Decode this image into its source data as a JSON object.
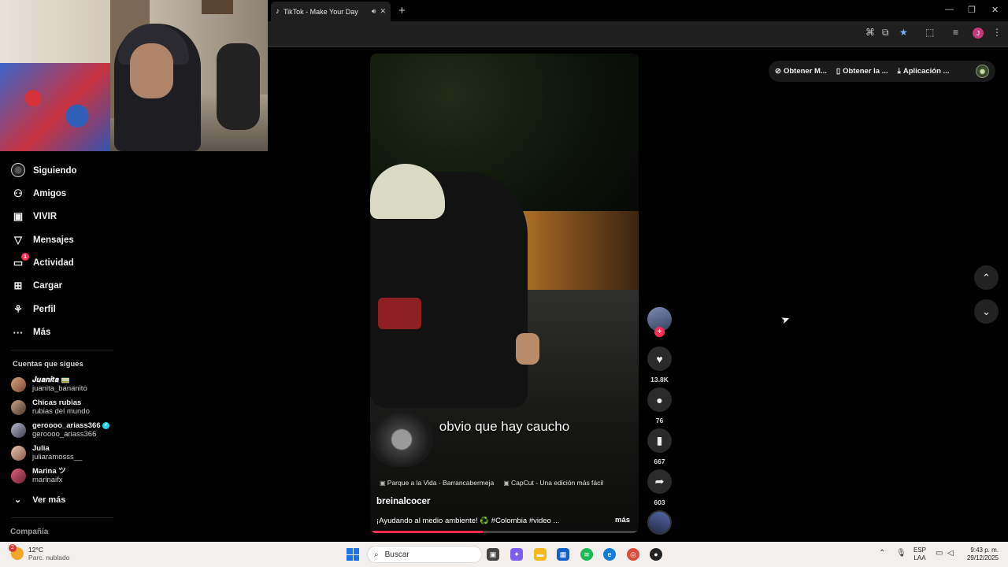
{
  "browser": {
    "tab_title": "TikTok - Make Your Day",
    "tab_icon": "tiktok-icon",
    "new_tab": "+",
    "profile_initial": "J"
  },
  "nav": {
    "items": [
      {
        "label": "Siguiendo",
        "icon": "following-ring-icon"
      },
      {
        "label": "Amigos",
        "icon": "friends-icon"
      },
      {
        "label": "VIVIR",
        "icon": "live-icon"
      },
      {
        "label": "Mensajes",
        "icon": "messages-icon"
      },
      {
        "label": "Actividad",
        "icon": "activity-icon",
        "badge": "1"
      },
      {
        "label": "Cargar",
        "icon": "upload-icon"
      },
      {
        "label": "Perfil",
        "icon": "profile-icon"
      },
      {
        "label": "Más",
        "icon": "more-icon"
      }
    ],
    "following_title": "Cuentas que sigues",
    "following": [
      {
        "name": "𝑱𝒖𝒂𝒏𝒊𝒕𝒂 🚃",
        "username": "juanita_bananito"
      },
      {
        "name": "Chicas rubias",
        "username": "rubias del mundo"
      },
      {
        "name": "geroooo_ariass366",
        "username": "geroooo_ariass366",
        "verified": true
      },
      {
        "name": "Julia",
        "username": "juliaramosss__"
      },
      {
        "name": "Marina ツ",
        "username": "marinaifx"
      }
    ],
    "see_more": "Ver más",
    "company": "Compañía"
  },
  "video": {
    "caption": "obvio que hay caucho",
    "tags": [
      "Parque a la Vida - Barrancabermeja",
      "CapCut - Una edición más fácil"
    ],
    "username": "breinalcocer",
    "description": "¡Ayudando al medio ambiente! ♻️ #Colombia #video ...",
    "more": "más",
    "progress": 0.42
  },
  "actions": {
    "likes": "13.8K",
    "comments": "76",
    "saves": "667",
    "shares": "603"
  },
  "topbar": {
    "items": [
      "Obtener M...",
      "Obtener la ...",
      "Aplicación ..."
    ]
  },
  "taskbar": {
    "weather_temp": "12°C",
    "weather_desc": "Parc. nublado",
    "weather_badge": "2",
    "search_placeholder": "Buscar",
    "lang_line1": "ESP",
    "lang_line2": "LAA",
    "time": "9:43 p. m.",
    "date": "29/12/2025"
  }
}
